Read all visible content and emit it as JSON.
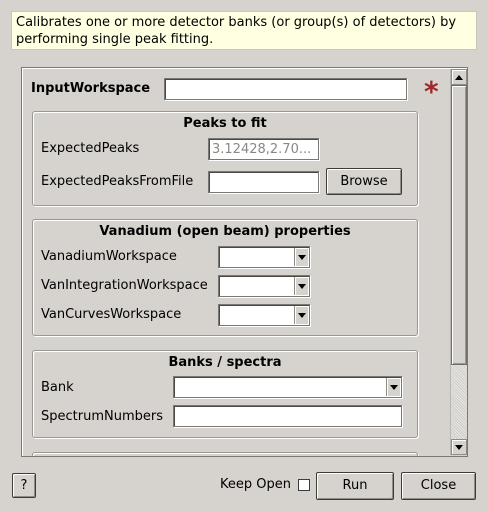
{
  "description": "Calibrates one or more detector banks (or group(s) of detectors) by performing single peak fitting.",
  "input_workspace": {
    "label": "InputWorkspace",
    "value": ""
  },
  "required_marker": "*",
  "peaks_group": {
    "title": "Peaks to fit",
    "expected_peaks": {
      "label": "ExpectedPeaks",
      "value": "3.12428,2.70..."
    },
    "expected_peaks_file": {
      "label": "ExpectedPeaksFromFile",
      "value": "",
      "browse": "Browse"
    }
  },
  "vanadium_group": {
    "title": "Vanadium (open beam) properties",
    "vanadium_ws": {
      "label": "VanadiumWorkspace",
      "value": ""
    },
    "van_integration_ws": {
      "label": "VanIntegrationWorkspace",
      "value": ""
    },
    "van_curves_ws": {
      "label": "VanCurvesWorkspace",
      "value": ""
    }
  },
  "banks_group": {
    "title": "Banks / spectra",
    "bank": {
      "label": "Bank",
      "value": ""
    },
    "spectrum_numbers": {
      "label": "SpectrumNumbers",
      "value": ""
    }
  },
  "footer": {
    "help": "?",
    "keep_open": "Keep Open",
    "keep_open_checked": false,
    "run": "Run",
    "close": "Close"
  }
}
